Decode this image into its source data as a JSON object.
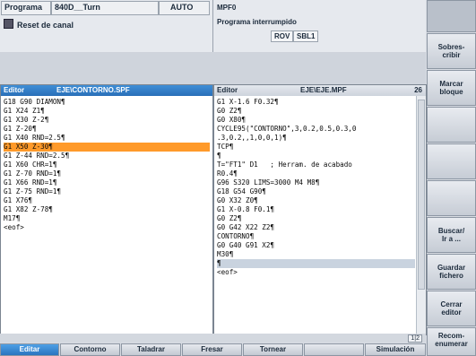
{
  "header": {
    "program_label": "Programa",
    "channel": "840D__Turn",
    "mode": "AUTO",
    "program_name": "MPF0",
    "reset_text": "Reset de canal",
    "status_text": "Programa interrumpido",
    "rov": "ROV",
    "sbl": "SBL1"
  },
  "left_editor": {
    "title_prefix": "Editor",
    "file": "EJE\\CONTORNO.SPF",
    "lines": [
      "G18 G90 DIAMON¶",
      "G1 X24 Z1¶",
      "G1 X30 Z-2¶",
      "G1 Z-20¶",
      "G1 X40 RND=2.5¶",
      "G1 X50 Z-30¶",
      "G1 Z-44 RND=2.5¶",
      "G1 X60 CHR=1¶",
      "G1 Z-70 RND=1¶",
      "G1 X66 RND=1¶",
      "G1 Z-75 RND=1¶",
      "G1 X76¶",
      "G1 X82 Z-78¶",
      "M17¶",
      "<eof>"
    ]
  },
  "right_editor": {
    "title_prefix": "Editor",
    "file": "EJE\\EJE.MPF",
    "line_number": "26",
    "lines": [
      "G1 X-1.6 F0.32¶",
      "G0 Z2¶",
      "G0 X80¶",
      "CYCLE95(\"CONTORNO\",3,0.2,0.5,0.3,0",
      ".3,0.2,,1,0,0,1)¶",
      "TCP¶",
      "¶",
      "T=\"FT1\" D1   ; Herram. de acabado",
      "R0.4¶",
      "G96 S320 LIMS=3000 M4 M8¶",
      "G18 G54 G90¶",
      "G0 X32 Z0¶",
      "G1 X-0.8 F0.1¶",
      "G0 Z2¶",
      "G0 G42 X22 Z2¶",
      "CONTORNO¶",
      "G0 G40 G91 X2¶",
      "M30¶",
      "¶",
      "<eof>"
    ]
  },
  "page_indicator": "1|2",
  "right_softkeys": [
    "Sobres-\ncribir",
    "Marcar\nbloque",
    "",
    "",
    "",
    "Buscar/\nIr a ...",
    "Guardar\nfichero",
    "Cerrar\neditor"
  ],
  "corner_softkey": "Recom-\nenumerar",
  "bottom_softkeys": [
    "Editar",
    "Contorno",
    "Taladrar",
    "Fresar",
    "Tornear",
    "",
    "Simulación"
  ],
  "colors": {
    "selection": "#ff9a2a",
    "active_title": "#2a6fb8",
    "active_softkey": "#2a74bf"
  }
}
